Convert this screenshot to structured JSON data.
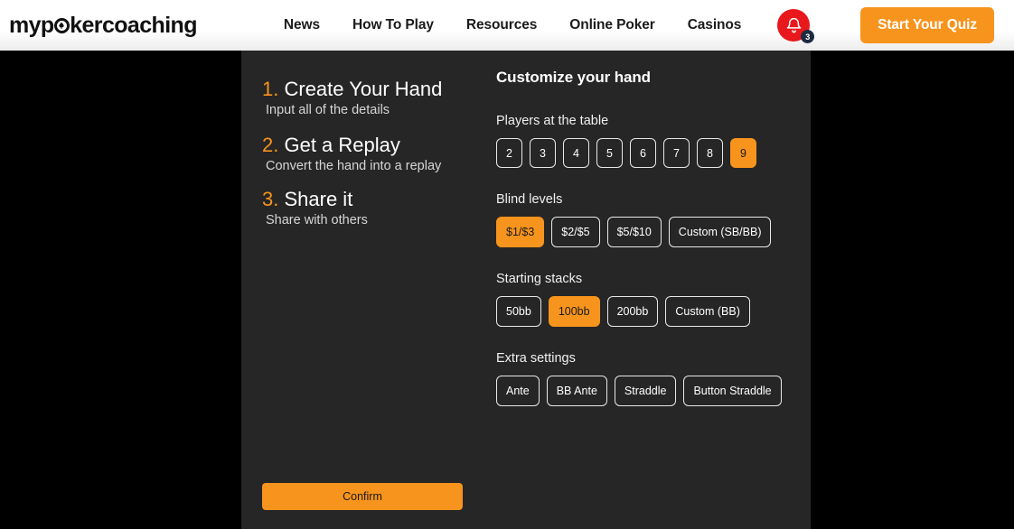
{
  "header": {
    "logo_pre": "myp",
    "logo_o_icon": "spade-in-o-icon",
    "logo_post": "kercoaching",
    "nav": [
      {
        "label": "News"
      },
      {
        "label": "How To Play"
      },
      {
        "label": "Resources"
      },
      {
        "label": "Online Poker"
      },
      {
        "label": "Casinos"
      }
    ],
    "notifications": {
      "icon": "bell-icon",
      "count": "3",
      "circle_color": "#e8181c",
      "badge_color": "#1d2b40"
    },
    "cta": {
      "label": "Start Your Quiz",
      "color": "#f7941d"
    }
  },
  "steps": [
    {
      "num": "1.",
      "title": "Create Your Hand",
      "sub": "Input all of the details"
    },
    {
      "num": "2.",
      "title": "Get a Replay",
      "sub": "Convert the hand into a replay"
    },
    {
      "num": "3.",
      "title": "Share it",
      "sub": "Share with others"
    }
  ],
  "confirm": {
    "label": "Confirm"
  },
  "customize": {
    "heading": "Customize your hand",
    "groups": [
      {
        "label": "Players at the table",
        "options": [
          {
            "label": "2",
            "selected": false
          },
          {
            "label": "3",
            "selected": false
          },
          {
            "label": "4",
            "selected": false
          },
          {
            "label": "5",
            "selected": false
          },
          {
            "label": "6",
            "selected": false
          },
          {
            "label": "7",
            "selected": false
          },
          {
            "label": "8",
            "selected": false
          },
          {
            "label": "9",
            "selected": true
          }
        ]
      },
      {
        "label": "Blind levels",
        "options": [
          {
            "label": "$1/$3",
            "selected": true
          },
          {
            "label": "$2/$5",
            "selected": false
          },
          {
            "label": "$5/$10",
            "selected": false
          },
          {
            "label": "Custom (SB/BB)",
            "selected": false
          }
        ]
      },
      {
        "label": "Starting stacks",
        "options": [
          {
            "label": "50bb",
            "selected": false
          },
          {
            "label": "100bb",
            "selected": true
          },
          {
            "label": "200bb",
            "selected": false
          },
          {
            "label": "Custom (BB)",
            "selected": false
          }
        ]
      },
      {
        "label": "Extra settings",
        "options": [
          {
            "label": "Ante",
            "selected": false
          },
          {
            "label": "BB Ante",
            "selected": false
          },
          {
            "label": "Straddle",
            "selected": false
          },
          {
            "label": "Button Straddle",
            "selected": false
          }
        ]
      }
    ]
  }
}
